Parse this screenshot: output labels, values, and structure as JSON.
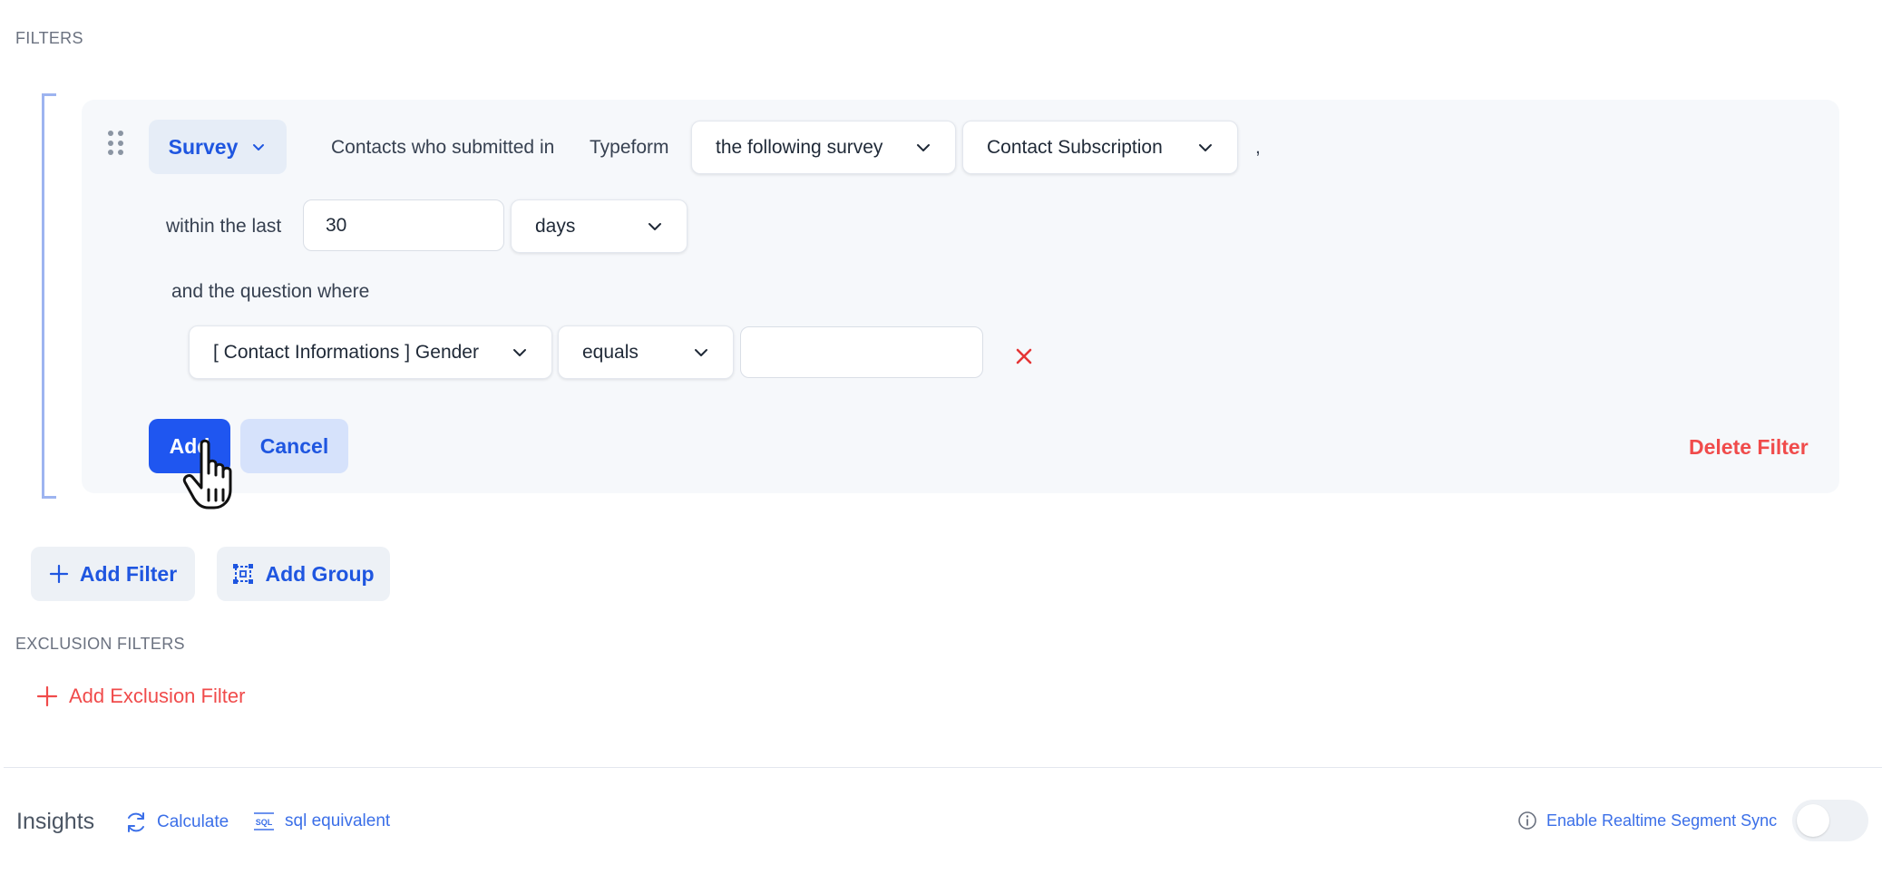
{
  "filters": {
    "section_label": "FILTERS",
    "filter": {
      "type_label": "Survey",
      "text_contacts": "Contacts who submitted in",
      "text_source": "Typeform",
      "survey_mode": "the following survey",
      "survey_name": "Contact Subscription",
      "comma": ",",
      "within_label": "within the last",
      "within_value": "30",
      "unit": "days",
      "question_label": "and the question where",
      "question_field": "[ Contact Informations ] Gender",
      "operator": "equals",
      "question_value": "",
      "add_label": "Add",
      "cancel_label": "Cancel",
      "delete_label": "Delete Filter"
    },
    "add_filter_label": "Add Filter",
    "add_group_label": "Add Group"
  },
  "exclusion": {
    "section_label": "EXCLUSION FILTERS",
    "add_label": "Add Exclusion Filter"
  },
  "insights": {
    "title": "Insights",
    "calculate_label": "Calculate",
    "sql_label": "sql equivalent",
    "sql_icon_text": "SQL",
    "realtime_label": "Enable Realtime Segment Sync",
    "realtime_enabled": false
  },
  "colors": {
    "primary": "#1f56f0",
    "danger": "#f04b4b",
    "panel": "#f6f8fb"
  },
  "icons": [
    "grip-icon",
    "chevron-down-icon",
    "close-icon",
    "plus-icon",
    "group-icon",
    "refresh-icon",
    "sql-icon",
    "info-icon",
    "hand-cursor-icon"
  ]
}
